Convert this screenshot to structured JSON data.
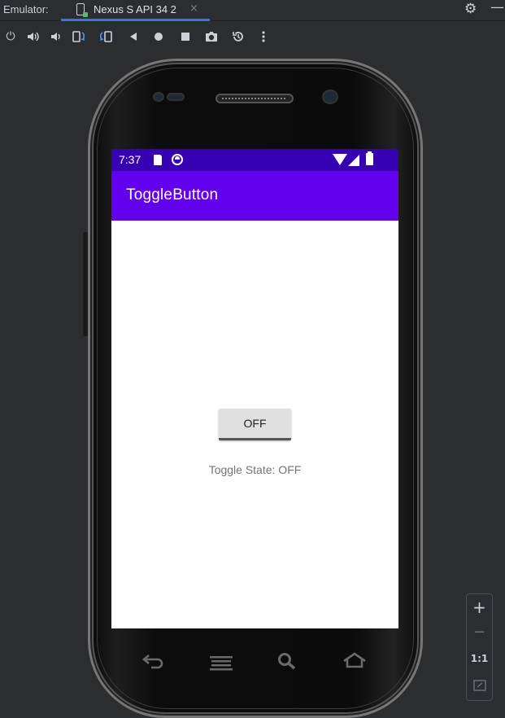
{
  "tabbar": {
    "label": "Emulator:",
    "tab_title": "Nexus S API 34 2",
    "close_glyph": "×",
    "settings_icon": "gear-icon",
    "minimize_icon": "minimize-icon"
  },
  "toolbar": {
    "icons": [
      "power-icon",
      "volume-up-icon",
      "volume-down-icon",
      "rotate-left-icon",
      "rotate-right-icon",
      "back-icon",
      "home-icon",
      "overview-icon",
      "screenshot-icon",
      "snapshot-icon",
      "more-icon"
    ]
  },
  "device": {
    "status_bar": {
      "time": "7:37",
      "icons": [
        "sd-card-icon",
        "sync-icon",
        "wifi-icon",
        "signal-icon",
        "battery-icon"
      ]
    },
    "app_bar": {
      "title": "ToggleButton",
      "color": "#6200ee",
      "status_color": "#3700b3"
    },
    "toggle_button": {
      "label": "OFF"
    },
    "state_text": "Toggle State: OFF",
    "nav_keys": [
      "back-key-icon",
      "menu-key-icon",
      "search-key-icon",
      "home-key-icon"
    ]
  },
  "zoom": {
    "plus": "+",
    "minus": "−",
    "one_to_one": "1:1"
  }
}
